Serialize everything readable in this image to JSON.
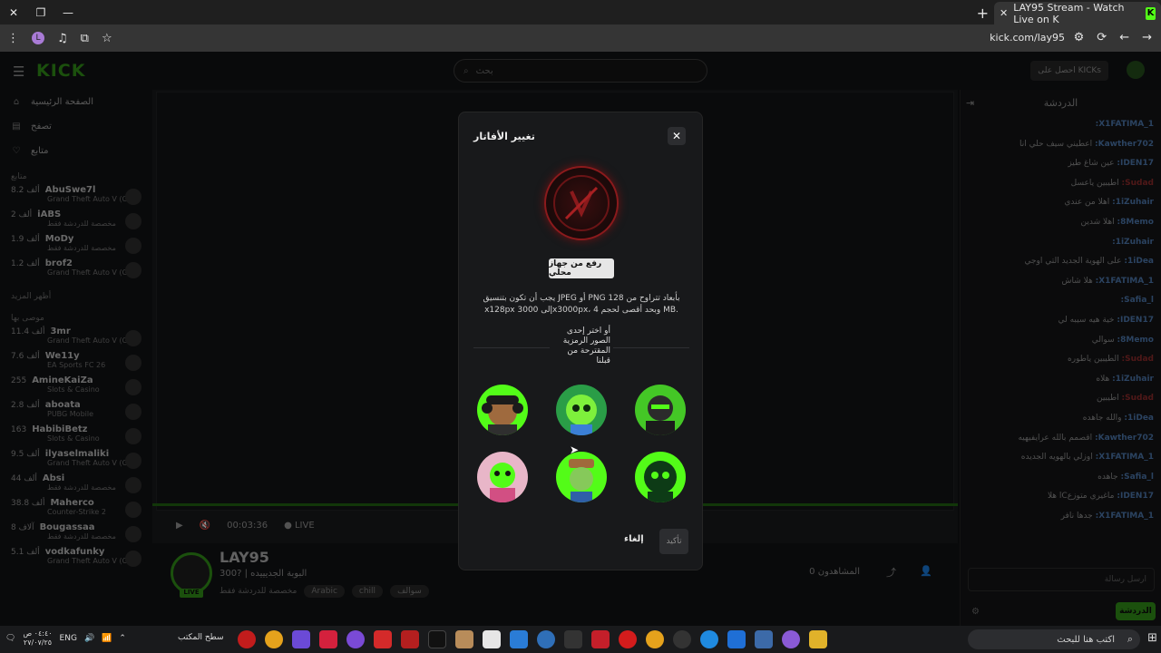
{
  "browser": {
    "tab_title": "LAY95 Stream - Watch Live on K",
    "tab_favicon": "K",
    "url": "kick.com/lay95",
    "profile_initial": "L"
  },
  "kick": {
    "logo": "KICK",
    "search_placeholder": "بحث",
    "get_kicks": "احصل على KICKs",
    "nav": [
      {
        "label": "الصفحة الرئيسية",
        "icon": "home-icon"
      },
      {
        "label": "تصفح",
        "icon": "browse-icon"
      },
      {
        "label": "متابع",
        "icon": "heart-icon"
      }
    ],
    "following_heading": "متابع",
    "following": [
      {
        "name": "AbuSwe7l",
        "count": "8.2 ألف",
        "game": "Grand Theft Auto V (GTA)"
      },
      {
        "name": "iABS",
        "count": "2 ألف",
        "game": "مخصصة للدردشة فقط"
      },
      {
        "name": "MoDy",
        "count": "1.9 ألف",
        "game": "مخصصة للدردشة فقط"
      },
      {
        "name": "brof2",
        "count": "1.2 ألف",
        "game": "Grand Theft Auto V (GTA)"
      }
    ],
    "show_more": "أظهر المزيد",
    "recommended_heading": "موصى بها",
    "recommended": [
      {
        "name": "3mr",
        "count": "11.4 ألف",
        "game": "Grand Theft Auto V (GTA)"
      },
      {
        "name": "We11y",
        "count": "7.6 ألف",
        "game": "EA Sports FC 26"
      },
      {
        "name": "AmineKaiZa",
        "count": "255",
        "game": "Slots & Casino"
      },
      {
        "name": "aboata",
        "count": "2.8 ألف",
        "game": "PUBG Mobile"
      },
      {
        "name": "HabibiBetz",
        "count": "163",
        "game": "Slots & Casino"
      },
      {
        "name": "ilyaselmaliki",
        "count": "9.5 ألف",
        "game": "Grand Theft Auto V (GTA)"
      },
      {
        "name": "Absi",
        "count": "44 ألف",
        "game": "مخصصة للدردشة فقط"
      },
      {
        "name": "Maherco",
        "count": "38.8 ألف",
        "game": "Counter-Strike 2"
      },
      {
        "name": "Bougassaa",
        "count": "8 آلاف",
        "game": "مخصصة للدردشة فقط"
      },
      {
        "name": "vodkafunky",
        "count": "5.1 ألف",
        "game": "Grand Theft Auto V (GTA)"
      }
    ],
    "player": {
      "time": "00:03:36",
      "live": "LIVE"
    },
    "stream": {
      "streamer": "LAY95",
      "title": "البوبة الجديييده | ?300",
      "category": "مخصصة للدردشة فقط",
      "tags": [
        "Arabic",
        "chill",
        "سوالف"
      ],
      "viewers": "المشاهدون 0",
      "live_badge": "LIVE"
    },
    "chat": {
      "title": "الدردشة",
      "messages": [
        {
          "user": "X1FATIMA_1:",
          "text": "",
          "color": "blue"
        },
        {
          "user": "Kawther702:",
          "text": "اعطيني سيف حلي انا",
          "color": "blue"
        },
        {
          "user": "IDEN17:",
          "text": "عين شاغ طيز",
          "color": "blue"
        },
        {
          "user": "Sudad:",
          "text": "اطيبين ياعسل",
          "color": "red"
        },
        {
          "user": "1iZuhair:",
          "text": "اهلا من عندي",
          "color": "blue"
        },
        {
          "user": "8Memo:",
          "text": "اهلا شدين",
          "color": "blue"
        },
        {
          "user": "1iZuhair:",
          "text": "",
          "color": "blue"
        },
        {
          "user": "1iDea:",
          "text": "على الهوية الجديد التي اوجي",
          "color": "blue"
        },
        {
          "user": "X1FATIMA_1:",
          "text": "هلا شاش",
          "color": "blue"
        },
        {
          "user": "Safia_l:",
          "text": "",
          "color": "blue"
        },
        {
          "user": "IDEN17:",
          "text": "خية هيه سيبه لي",
          "color": "blue"
        },
        {
          "user": "8Memo:",
          "text": "سوالي",
          "color": "blue"
        },
        {
          "user": "Sudad:",
          "text": "الطيبين ياطوره",
          "color": "red"
        },
        {
          "user": "1iZuhair:",
          "text": "هلاه",
          "color": "blue"
        },
        {
          "user": "Sudad:",
          "text": "اطيبين",
          "color": "red"
        },
        {
          "user": "1iDea:",
          "text": "والله جاهده",
          "color": "blue"
        },
        {
          "user": "Kawther702:",
          "text": "اقصمم بالله عرايفيهيه",
          "color": "blue"
        },
        {
          "user": "X1FATIMA_1:",
          "text": "اوزلي بالهويه الجديده",
          "color": "blue"
        },
        {
          "user": "Safia_l:",
          "text": "جاهده",
          "color": "blue"
        },
        {
          "user": "IDEN17:",
          "text": "ماغيري متوزعCا هلا",
          "color": "blue"
        },
        {
          "user": "X1FATIMA_1:",
          "text": "جدها نافر",
          "color": "blue"
        }
      ],
      "input_placeholder": "ارسل رسالة",
      "send": "الدردشة"
    }
  },
  "modal": {
    "title": "تغيير الأفاتار",
    "close": "✕",
    "upload_label": "رفع من جهاز محلي",
    "hint": "يجب أن تكون بتنسيق JPEG أو PNG 128 بأبعاد تتراوح من x128px إلى 3000x3000px، وبحد أقصى لحجم 4 MB.",
    "or_label": "أو اختر إحدى الصور الرمزية المقترحة من قبلنا",
    "suggested": [
      {
        "name": "avatar-headphones-green",
        "bg": "#53fc18"
      },
      {
        "name": "avatar-green-robot",
        "bg": "#3fd61a"
      },
      {
        "name": "avatar-green-dark",
        "bg": "#2c2c2c"
      },
      {
        "name": "avatar-pink-clown",
        "bg": "#e8b6c8"
      },
      {
        "name": "avatar-hat-green",
        "bg": "#53fc18"
      },
      {
        "name": "avatar-dark-glow",
        "bg": "#0b5d1e"
      }
    ],
    "cancel": "إلغاء",
    "confirm": "تأكيد"
  },
  "taskbar": {
    "search_placeholder": "اكتب هنا للبحث",
    "desktop_label": "سطح المكتب",
    "lang": "ENG",
    "time": "٠٤:٤٠ ص",
    "date": "٢٧/٠٧/٢٥"
  },
  "colors": {
    "kick_green": "#53fc18",
    "modal_bg": "#18191b"
  }
}
